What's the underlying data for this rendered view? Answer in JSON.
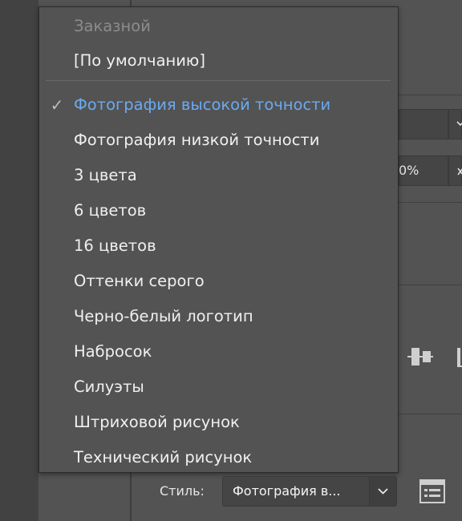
{
  "menu": {
    "items": [
      {
        "label": "Заказной",
        "state": "disabled"
      },
      {
        "label": "[По умолчанию]",
        "state": "normal"
      },
      {
        "label": "Фотография высокой точности",
        "state": "selected"
      },
      {
        "label": "Фотография низкой точности",
        "state": "normal"
      },
      {
        "label": "3 цвета",
        "state": "normal"
      },
      {
        "label": "6 цветов",
        "state": "normal"
      },
      {
        "label": "16 цветов",
        "state": "normal"
      },
      {
        "label": "Оттенки серого",
        "state": "normal"
      },
      {
        "label": "Черно-белый логотип",
        "state": "normal"
      },
      {
        "label": "Набросок",
        "state": "normal"
      },
      {
        "label": "Силуэты",
        "state": "normal"
      },
      {
        "label": "Штриховой рисунок",
        "state": "normal"
      },
      {
        "label": "Технический рисунок",
        "state": "normal"
      }
    ],
    "check_glyph": "✓",
    "selected_color": "#6aaaf0",
    "disabled_color": "#8c8c8c"
  },
  "background": {
    "partial_percent": "0%"
  },
  "footer": {
    "style_label": "Стиль:",
    "style_value": "Фотография в..."
  },
  "icons": {
    "dropdown": "chevron-down-icon",
    "align": "align-center-icon",
    "list": "list-icon"
  }
}
